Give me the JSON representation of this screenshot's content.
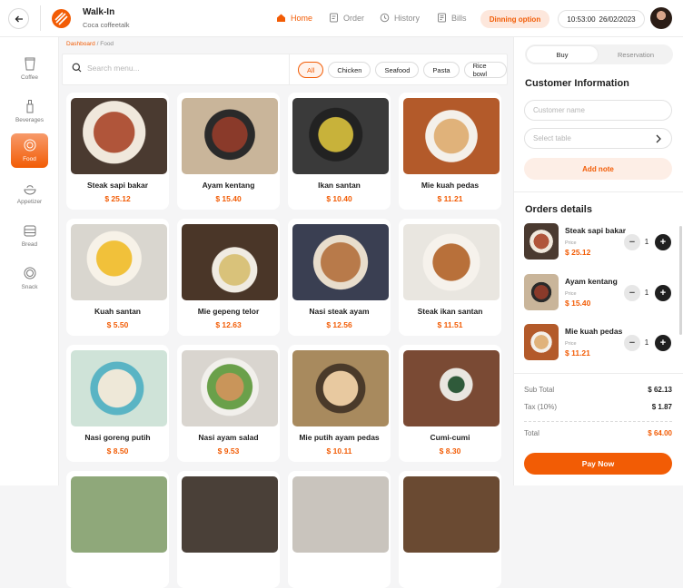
{
  "header": {
    "title": "Walk-In",
    "subtitle": "Coca coffeetalk",
    "nav": [
      {
        "label": "Home",
        "icon": "home-icon",
        "active": true
      },
      {
        "label": "Order",
        "icon": "order-icon",
        "active": false
      },
      {
        "label": "History",
        "icon": "history-icon",
        "active": false
      },
      {
        "label": "Bills",
        "icon": "bills-icon",
        "active": false
      }
    ],
    "dining": "Dinning option",
    "time": "10:53:00",
    "date": "26/02/2023"
  },
  "sidebar": {
    "items": [
      {
        "label": "Coffee",
        "icon": "coffee-cup-icon"
      },
      {
        "label": "Beverages",
        "icon": "bottle-icon"
      },
      {
        "label": "Food",
        "icon": "dish-icon",
        "active": true
      },
      {
        "label": "Appetizer",
        "icon": "appetizer-icon"
      },
      {
        "label": "Bread",
        "icon": "bread-icon"
      },
      {
        "label": "Snack",
        "icon": "snack-icon"
      }
    ]
  },
  "breadcrumb": {
    "root": "Dashboard",
    "current": "Food"
  },
  "search": {
    "placeholder": "Search menu..."
  },
  "filters": [
    "All",
    "Chicken",
    "Seafood",
    "Pasta",
    "Rice bowl"
  ],
  "menu": [
    {
      "name": "Steak sapi bakar",
      "price": "$ 25.12",
      "color": "#5a3a2a"
    },
    {
      "name": "Ayam kentang",
      "price": "$ 15.40",
      "color": "#6b4a3a"
    },
    {
      "name": "Ikan santan",
      "price": "$ 10.40",
      "color": "#2f2f2f"
    },
    {
      "name": "Mie kuah pedas",
      "price": "$ 11.21",
      "color": "#b35a2a"
    },
    {
      "name": "Kuah santan",
      "price": "$ 5.50",
      "color": "#e3a33a"
    },
    {
      "name": "Mie gepeng telor",
      "price": "$ 12.63",
      "color": "#5a4232"
    },
    {
      "name": "Nasi steak ayam",
      "price": "$ 12.56",
      "color": "#7a5237"
    },
    {
      "name": "Steak ikan santan",
      "price": "$ 11.51",
      "color": "#a86a42"
    },
    {
      "name": "Nasi goreng putih",
      "price": "$ 8.50",
      "color": "#9fc3a5"
    },
    {
      "name": "Nasi ayam salad",
      "price": "$ 9.53",
      "color": "#a5855f"
    },
    {
      "name": "Mie putih ayam pedas",
      "price": "$ 10.11",
      "color": "#9a7a55"
    },
    {
      "name": "Cumi-cumi",
      "price": "$ 8.30",
      "color": "#7a4a34"
    }
  ],
  "panel": {
    "tabs": [
      "Buy",
      "Reservation"
    ],
    "customer_title": "Customer Information",
    "customer_placeholder": "Customer name",
    "table_placeholder": "Select table",
    "add_note": "Add note",
    "orders_title": "Orders details",
    "price_label": "Price",
    "orders": [
      {
        "name": "Steak sapi bakar",
        "price": "$ 25.12",
        "qty": "1",
        "color": "#5a3a2a"
      },
      {
        "name": "Ayam kentang",
        "price": "$ 15.40",
        "qty": "1",
        "color": "#6b4a3a"
      },
      {
        "name": "Mie kuah pedas",
        "price": "$ 11.21",
        "qty": "1",
        "color": "#b35a2a"
      }
    ],
    "subtotal_label": "Sub Total",
    "subtotal": "$ 62.13",
    "tax_label": "Tax (10%)",
    "tax": "$ 1.87",
    "total_label": "Total",
    "total": "$ 64.00",
    "pay": "Pay Now"
  },
  "colors": {
    "accent": "#f25c05"
  }
}
